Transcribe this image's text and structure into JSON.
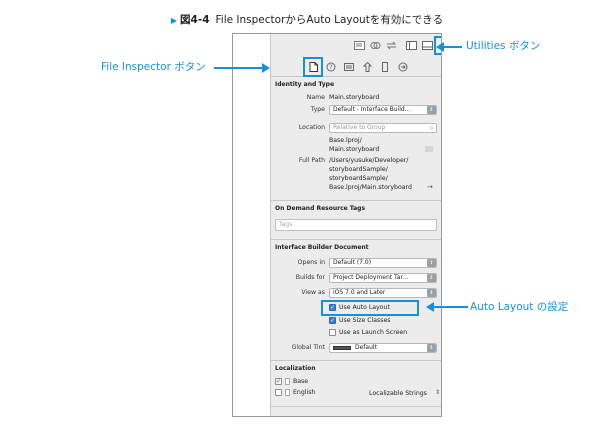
{
  "caption": {
    "figure_number": "図4-4",
    "text": "File InspectorからAuto Layoutを有効にできる"
  },
  "annotations": {
    "utilities": "Utilities ボタン",
    "file_inspector": "File Inspector ボタン",
    "auto_layout": "Auto Layout の設定"
  },
  "toolbar": {
    "icons": [
      "align-left-icon",
      "link-icon",
      "back-forward-icon",
      "navigator-panel-icon",
      "debug-panel-icon",
      "utilities-panel-icon"
    ]
  },
  "tabs": {
    "icons": [
      "file-inspector-icon",
      "help-icon",
      "identity-icon",
      "attributes-icon",
      "size-icon",
      "connections-icon"
    ]
  },
  "identity": {
    "heading": "Identity and Type",
    "name_label": "Name",
    "name_value": "Main.storyboard",
    "type_label": "Type",
    "type_value": "Default - Interface Build...",
    "location_label": "Location",
    "location_value": "Relative to Group",
    "location_path_1": "Base.lproj/",
    "location_path_2": "Main.storyboard",
    "full_path_label": "Full Path",
    "full_path_lines": [
      "/Users/yusuke/Developer/",
      "storyboardSample/",
      "storyboardSample/",
      "Base.lproj/Main.storyboard"
    ]
  },
  "on_demand": {
    "heading": "On Demand Resource Tags",
    "tags_placeholder": "Tags"
  },
  "ib_document": {
    "heading": "Interface Builder Document",
    "opens_in_label": "Opens in",
    "opens_in_value": "Default (7.0)",
    "builds_for_label": "Builds for",
    "builds_for_value": "Project Deployment Tar...",
    "view_as_label": "View as",
    "view_as_value": "iOS 7.0 and Later",
    "use_auto_layout": "Use Auto Layout",
    "use_size_classes": "Use Size Classes",
    "use_as_launch_screen": "Use as Launch Screen",
    "use_auto_layout_checked": true,
    "use_size_classes_checked": true,
    "use_as_launch_screen_checked": false,
    "global_tint_label": "Global Tint",
    "global_tint_value": "Default"
  },
  "localization": {
    "heading": "Localization",
    "rows": [
      {
        "name": "Base",
        "checked": true,
        "value": ""
      },
      {
        "name": "English",
        "checked": false,
        "value": "Localizable Strings"
      }
    ]
  },
  "colors": {
    "accent": "#1a8fd6",
    "checkbox_on": "#3a7bd5"
  }
}
